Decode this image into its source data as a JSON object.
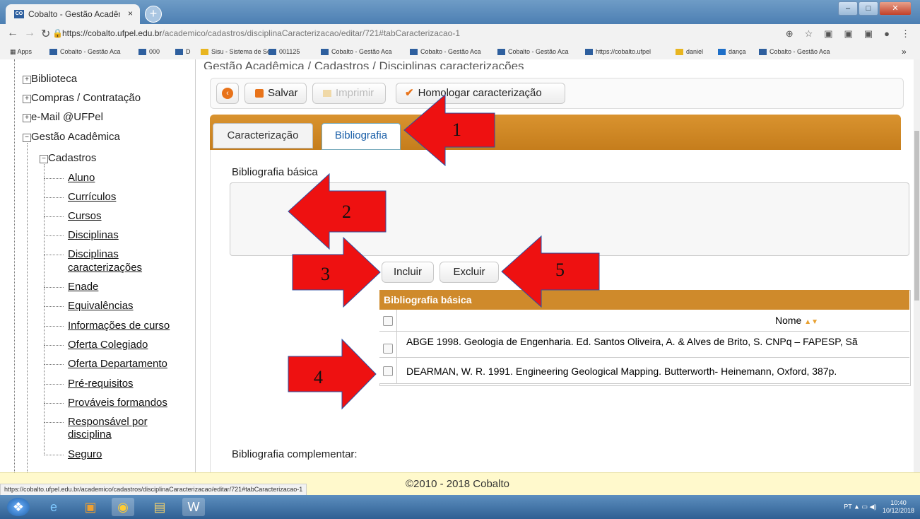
{
  "browser": {
    "tab_title": "Cobalto - Gestão Acadêmica / Ca",
    "tab_close": "×",
    "new_tab": "+",
    "url_host": "https://cobalto.ufpel.edu.br",
    "url_path": "/academico/cadastros/disciplinaCaracterizacao/editar/721#tabCaracterizacao-1",
    "bookmarks": [
      "Apps",
      "Cobalto - Gestão Aca",
      "000",
      "D",
      "Sisu - Sistema de Sel",
      "001125",
      "Cobalto - Gestão Aca",
      "Cobalto - Gestão Aca",
      "Cobalto - Gestão Aca",
      "https://cobalto.ufpel",
      "daniel",
      "dança",
      "Cobalto - Gestão Aca"
    ],
    "bookmarks_more": "»",
    "status_url": "https://cobalto.ufpel.edu.br/academico/cadastros/disciplinaCaracterizacao/editar/721#tabCaracterizacao-1"
  },
  "sidebar": {
    "top_nodes": [
      "Biblioteca",
      "Compras / Contratação",
      "e-Mail @UFPel",
      "Gestão Acadêmica"
    ],
    "sub_node": "Cadastros",
    "links": [
      "Aluno",
      "Currículos",
      "Cursos",
      "Disciplinas",
      "Disciplinas",
      "caracterizações",
      "Enade",
      "Equivalências",
      "Informações de curso",
      "Oferta Colegiado",
      "Oferta Departamento",
      "Pré-requisitos",
      "Prováveis formandos",
      "Responsável por",
      "disciplina",
      "Seguro"
    ]
  },
  "breadcrumb": "Gestão Acadêmica / Cadastros / Disciplinas caracterizações",
  "toolbar": {
    "save": "Salvar",
    "print": "Imprimir",
    "approve": "Homologar caracterização"
  },
  "tabs": {
    "caracterizacao": "Caracterização",
    "bibliografia": "Bibliografia"
  },
  "bib": {
    "basic_label": "Bibliografia básica",
    "include": "Incluir",
    "exclude": "Excluir",
    "grid_title": "Bibliografia básica",
    "col_name": "Nome",
    "rows": [
      "ABGE 1998. Geologia de Engenharia. Ed. Santos Oliveira, A. & Alves de Brito, S. CNPq – FAPESP, Sã",
      "DEARMAN, W. R. 1991. Engineering Geological Mapping. Butterworth- Heinemann, Oxford, 387p."
    ],
    "complementary_label": "Bibliografia complementar:"
  },
  "footer": "©2010 - 2018 Cobalto",
  "annotations": [
    "1",
    "2",
    "3",
    "4",
    "5"
  ],
  "tray": {
    "lang": "PT",
    "time": "10:40",
    "date": "10/12/2018"
  },
  "colors": {
    "accent_orange": "#cf8a2b",
    "arrow_red": "#ee1111",
    "footer_bg": "#fff9cc"
  }
}
